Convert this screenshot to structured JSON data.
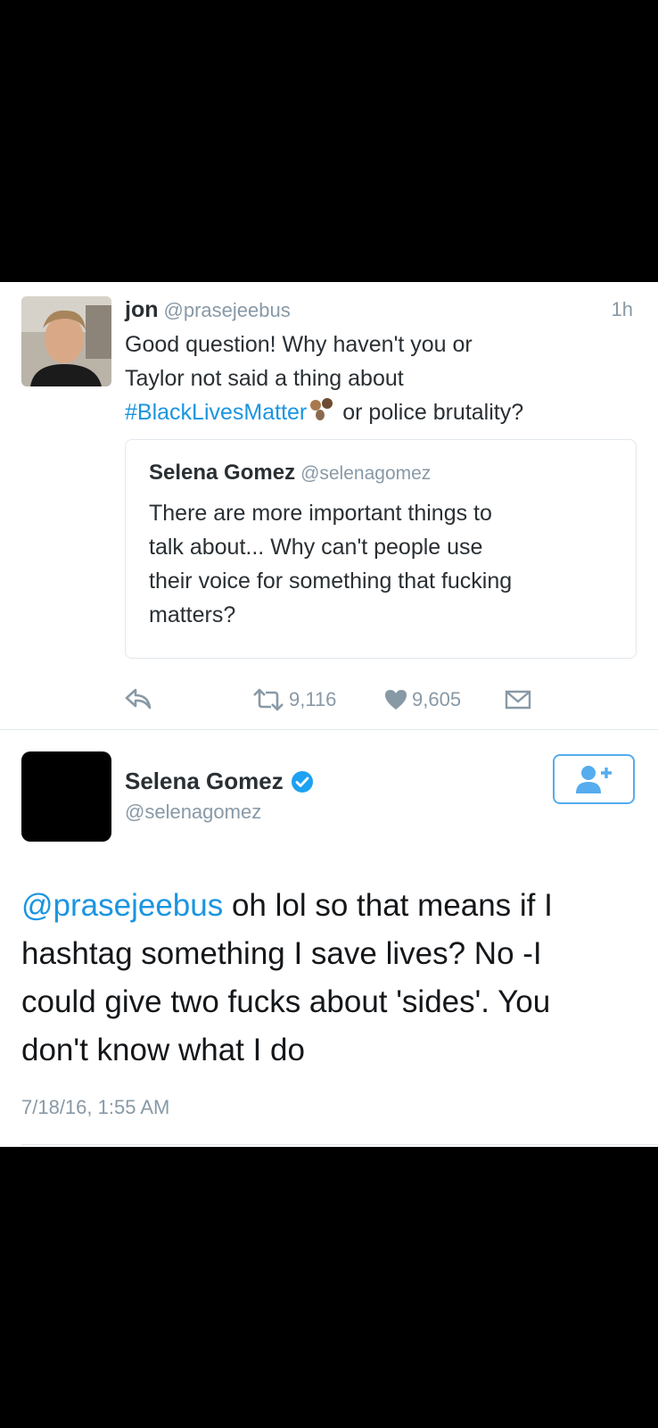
{
  "tweet1": {
    "name": "jon",
    "handle": "@prasejeebus",
    "time": "1h",
    "line1": "Good question! Why haven't you or",
    "line2": "Taylor not said a thing about",
    "hashtag": "#BlackLivesMatter",
    "line3_rest": "or police brutality?",
    "emoji": "fist-bump-emoji",
    "quote": {
      "name": "Selena Gomez",
      "handle": "@selenagomez",
      "lines": [
        "There are more important things to",
        "talk about... Why can't people use",
        "their voice for something that fucking",
        "matters?"
      ]
    },
    "actions": {
      "reply_icon": "reply-icon",
      "retweet_icon": "retweet-icon",
      "retweet_count": "9,116",
      "like_icon": "heart-icon",
      "like_count": "9,605",
      "dm_icon": "envelope-icon"
    }
  },
  "tweet2": {
    "name": "Selena Gomez",
    "handle": "@selenagomez",
    "verified_icon": "verified-badge-icon",
    "follow_icon": "add-user-icon",
    "mention": "@prasejeebus",
    "line1_rest": " oh lol so that means if I",
    "line2": "hashtag something I save lives? No -I",
    "line3": "could give two fucks about 'sides'. You",
    "line4": "don't know what I do",
    "timestamp": "7/18/16, 1:55 AM"
  },
  "colors": {
    "link": "#1b95e0",
    "muted": "#8899a6",
    "text": "#292f33",
    "border": "#e1e8ed",
    "follow": "#55acee"
  }
}
